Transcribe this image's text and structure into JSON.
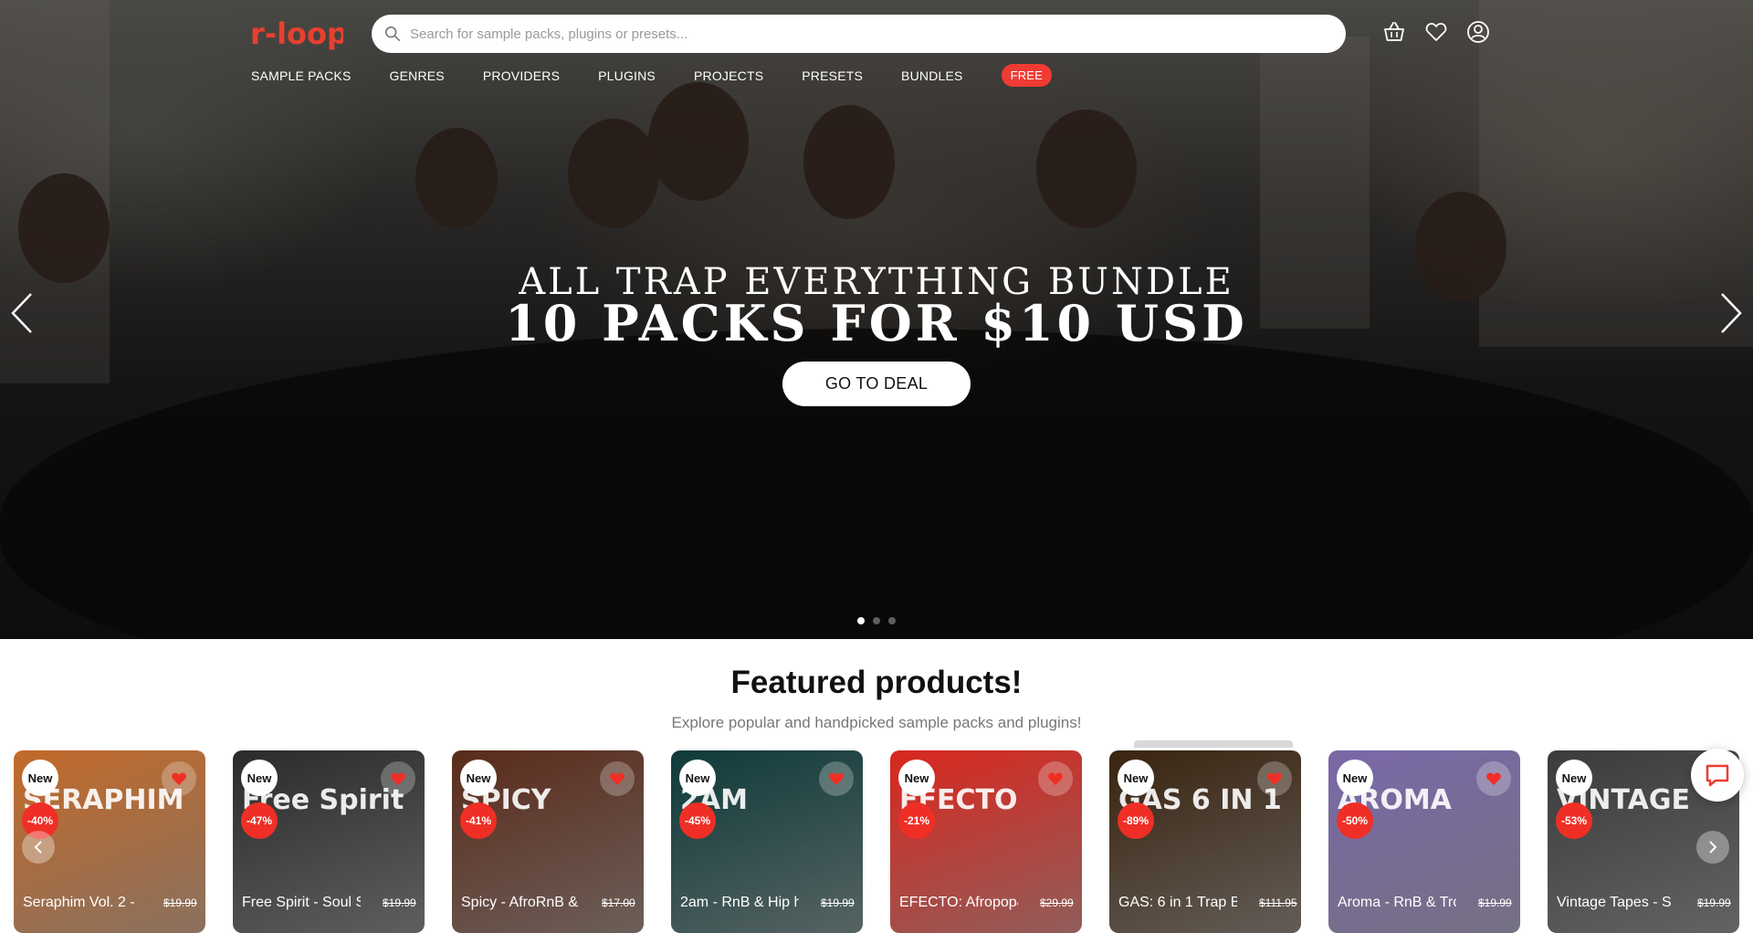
{
  "header": {
    "logo_text": "r-loops",
    "search_placeholder": "Search for sample packs, plugins or presets...",
    "icons": [
      "basket-icon",
      "heart-icon",
      "account-icon"
    ]
  },
  "nav": {
    "items": [
      "SAMPLE PACKS",
      "GENRES",
      "PROVIDERS",
      "PLUGINS",
      "PROJECTS",
      "PRESETS",
      "BUNDLES"
    ],
    "free_label": "FREE"
  },
  "hero": {
    "line1": "ALL TRAP EVERYTHING BUNDLE",
    "line2": "10 PACKS FOR $10 USD",
    "cta": "GO TO DEAL",
    "slides": 3,
    "active_slide": 1
  },
  "featured": {
    "title_bold": "Featured",
    "title_rest": " products!",
    "subtitle": "Explore popular and handpicked sample packs and plugins!"
  },
  "products": [
    {
      "badge": "New",
      "discount": "-40%",
      "art": "SERAPHIM",
      "name": "Seraphim Vol. 2 -",
      "price": "$19.99",
      "color": "#c26a2a"
    },
    {
      "badge": "New",
      "discount": "-47%",
      "art": "Free Spirit",
      "name": "Free Spirit - Soul S",
      "price": "$19.99",
      "color": "#2b2b2b"
    },
    {
      "badge": "New",
      "discount": "-41%",
      "art": "SPICY",
      "name": "Spicy - AfroRnB &",
      "price": "$17.00",
      "color": "#5a2b1a"
    },
    {
      "badge": "New",
      "discount": "-45%",
      "art": "2AM",
      "name": "2am - RnB & Hip h",
      "price": "$19.99",
      "color": "#0f3a3a"
    },
    {
      "badge": "New",
      "discount": "-21%",
      "art": "EFECTO",
      "name": "EFECTO: Afropop&",
      "price": "$29.99",
      "color": "#d9271e"
    },
    {
      "badge": "New",
      "discount": "-89%",
      "art": "GAS 6 IN 1",
      "name": "GAS: 6 in 1 Trap Bu",
      "price": "$111.95",
      "color": "#3a2410"
    },
    {
      "badge": "New",
      "discount": "-50%",
      "art": "AROMA",
      "name": "Aroma - RnB & Trc",
      "price": "$19.99",
      "color": "#7a68a8"
    },
    {
      "badge": "New",
      "discount": "-53%",
      "art": "VINTAGE",
      "name": "Vintage Tapes - S",
      "price": "$19.99",
      "color": "#3b3b3b"
    }
  ],
  "colors": {
    "accent": "#ef3b33",
    "discount": "#ef2f26"
  }
}
